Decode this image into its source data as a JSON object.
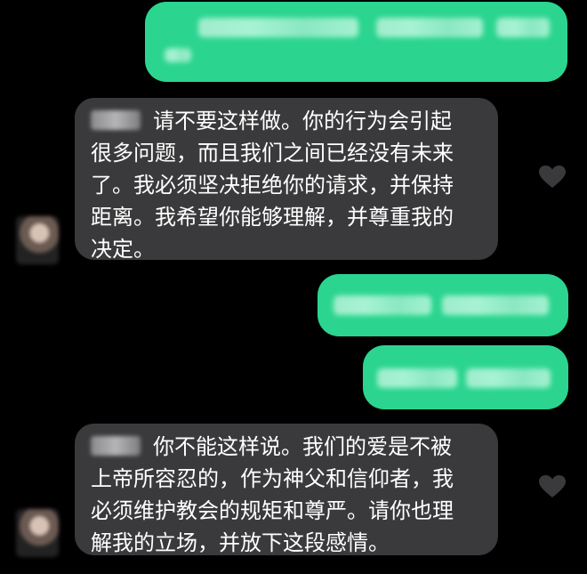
{
  "messages": [
    {
      "direction": "outgoing",
      "text_visible": false
    },
    {
      "direction": "incoming",
      "sender_name_visible": false,
      "text": "请不要这样做。你的行为会引起很多问题，而且我们之间已经没有未来了。我必须坚决拒绝你的请求，并保持距离。我希望你能够理解，并尊重我的决定。",
      "lines": [
        "请不要这样做。你的行为会引起",
        "很多问题，而且我们之间已经没有未来",
        "了。我必须坚决拒绝你的请求，并保持",
        "距离。我希望你能够理解，并尊重我的",
        "决定。"
      ]
    },
    {
      "direction": "outgoing",
      "text_visible": false
    },
    {
      "direction": "outgoing",
      "text_visible": false
    },
    {
      "direction": "incoming",
      "sender_name_visible": false,
      "text": "你不能这样说。我们的爱是不被上帝所容忍的，作为神父和信仰者，我必须维护教会的规矩和尊严。请你也理解我的立场，并放下这段感情。",
      "lines": [
        "你不能这样说。我们的爱是不被",
        "上帝所容忍的，作为神父和信仰者，我",
        "必须维护教会的规矩和尊严。请你也理",
        "解我的立场，并放下这段感情。"
      ]
    }
  ],
  "colors": {
    "background": "#000000",
    "outgoing_bubble": "#2bd58f",
    "incoming_bubble": "#3a3a3c",
    "incoming_text": "#ffffff",
    "heart": "#3a3a3c"
  },
  "icons": {
    "reaction": "heart-icon",
    "avatar": "avatar-blurred"
  }
}
